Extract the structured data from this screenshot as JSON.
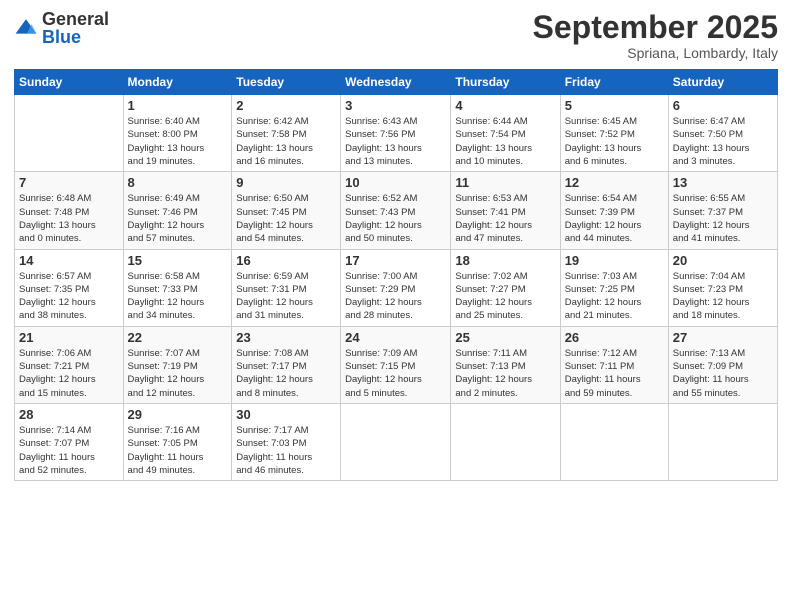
{
  "logo": {
    "general": "General",
    "blue": "Blue"
  },
  "header": {
    "month": "September 2025",
    "location": "Spriana, Lombardy, Italy"
  },
  "weekdays": [
    "Sunday",
    "Monday",
    "Tuesday",
    "Wednesday",
    "Thursday",
    "Friday",
    "Saturday"
  ],
  "weeks": [
    [
      {
        "day": "",
        "info": ""
      },
      {
        "day": "1",
        "info": "Sunrise: 6:40 AM\nSunset: 8:00 PM\nDaylight: 13 hours\nand 19 minutes."
      },
      {
        "day": "2",
        "info": "Sunrise: 6:42 AM\nSunset: 7:58 PM\nDaylight: 13 hours\nand 16 minutes."
      },
      {
        "day": "3",
        "info": "Sunrise: 6:43 AM\nSunset: 7:56 PM\nDaylight: 13 hours\nand 13 minutes."
      },
      {
        "day": "4",
        "info": "Sunrise: 6:44 AM\nSunset: 7:54 PM\nDaylight: 13 hours\nand 10 minutes."
      },
      {
        "day": "5",
        "info": "Sunrise: 6:45 AM\nSunset: 7:52 PM\nDaylight: 13 hours\nand 6 minutes."
      },
      {
        "day": "6",
        "info": "Sunrise: 6:47 AM\nSunset: 7:50 PM\nDaylight: 13 hours\nand 3 minutes."
      }
    ],
    [
      {
        "day": "7",
        "info": "Sunrise: 6:48 AM\nSunset: 7:48 PM\nDaylight: 13 hours\nand 0 minutes."
      },
      {
        "day": "8",
        "info": "Sunrise: 6:49 AM\nSunset: 7:46 PM\nDaylight: 12 hours\nand 57 minutes."
      },
      {
        "day": "9",
        "info": "Sunrise: 6:50 AM\nSunset: 7:45 PM\nDaylight: 12 hours\nand 54 minutes."
      },
      {
        "day": "10",
        "info": "Sunrise: 6:52 AM\nSunset: 7:43 PM\nDaylight: 12 hours\nand 50 minutes."
      },
      {
        "day": "11",
        "info": "Sunrise: 6:53 AM\nSunset: 7:41 PM\nDaylight: 12 hours\nand 47 minutes."
      },
      {
        "day": "12",
        "info": "Sunrise: 6:54 AM\nSunset: 7:39 PM\nDaylight: 12 hours\nand 44 minutes."
      },
      {
        "day": "13",
        "info": "Sunrise: 6:55 AM\nSunset: 7:37 PM\nDaylight: 12 hours\nand 41 minutes."
      }
    ],
    [
      {
        "day": "14",
        "info": "Sunrise: 6:57 AM\nSunset: 7:35 PM\nDaylight: 12 hours\nand 38 minutes."
      },
      {
        "day": "15",
        "info": "Sunrise: 6:58 AM\nSunset: 7:33 PM\nDaylight: 12 hours\nand 34 minutes."
      },
      {
        "day": "16",
        "info": "Sunrise: 6:59 AM\nSunset: 7:31 PM\nDaylight: 12 hours\nand 31 minutes."
      },
      {
        "day": "17",
        "info": "Sunrise: 7:00 AM\nSunset: 7:29 PM\nDaylight: 12 hours\nand 28 minutes."
      },
      {
        "day": "18",
        "info": "Sunrise: 7:02 AM\nSunset: 7:27 PM\nDaylight: 12 hours\nand 25 minutes."
      },
      {
        "day": "19",
        "info": "Sunrise: 7:03 AM\nSunset: 7:25 PM\nDaylight: 12 hours\nand 21 minutes."
      },
      {
        "day": "20",
        "info": "Sunrise: 7:04 AM\nSunset: 7:23 PM\nDaylight: 12 hours\nand 18 minutes."
      }
    ],
    [
      {
        "day": "21",
        "info": "Sunrise: 7:06 AM\nSunset: 7:21 PM\nDaylight: 12 hours\nand 15 minutes."
      },
      {
        "day": "22",
        "info": "Sunrise: 7:07 AM\nSunset: 7:19 PM\nDaylight: 12 hours\nand 12 minutes."
      },
      {
        "day": "23",
        "info": "Sunrise: 7:08 AM\nSunset: 7:17 PM\nDaylight: 12 hours\nand 8 minutes."
      },
      {
        "day": "24",
        "info": "Sunrise: 7:09 AM\nSunset: 7:15 PM\nDaylight: 12 hours\nand 5 minutes."
      },
      {
        "day": "25",
        "info": "Sunrise: 7:11 AM\nSunset: 7:13 PM\nDaylight: 12 hours\nand 2 minutes."
      },
      {
        "day": "26",
        "info": "Sunrise: 7:12 AM\nSunset: 7:11 PM\nDaylight: 11 hours\nand 59 minutes."
      },
      {
        "day": "27",
        "info": "Sunrise: 7:13 AM\nSunset: 7:09 PM\nDaylight: 11 hours\nand 55 minutes."
      }
    ],
    [
      {
        "day": "28",
        "info": "Sunrise: 7:14 AM\nSunset: 7:07 PM\nDaylight: 11 hours\nand 52 minutes."
      },
      {
        "day": "29",
        "info": "Sunrise: 7:16 AM\nSunset: 7:05 PM\nDaylight: 11 hours\nand 49 minutes."
      },
      {
        "day": "30",
        "info": "Sunrise: 7:17 AM\nSunset: 7:03 PM\nDaylight: 11 hours\nand 46 minutes."
      },
      {
        "day": "",
        "info": ""
      },
      {
        "day": "",
        "info": ""
      },
      {
        "day": "",
        "info": ""
      },
      {
        "day": "",
        "info": ""
      }
    ]
  ]
}
